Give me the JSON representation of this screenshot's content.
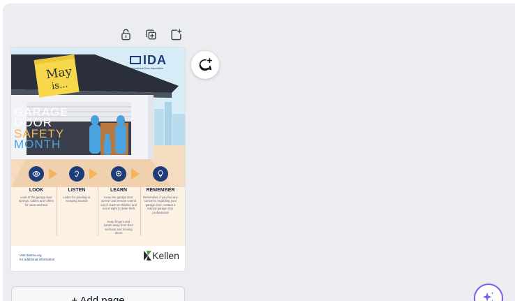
{
  "toolbar": {
    "lock_icon": "lock-icon",
    "duplicate_icon": "duplicate-page-icon",
    "add_icon": "add-page-icon"
  },
  "poster": {
    "sticky_note": {
      "line1": "May",
      "line2": "is..."
    },
    "brand": {
      "logo": "IDA",
      "subtitle": "International Door Association"
    },
    "headline": {
      "line1": "GARAGE",
      "line2": "DOOR",
      "line3": "SAFETY",
      "line4": "MONTH"
    },
    "steps": [
      {
        "title": "LOOK",
        "text": "Look at the garage door springs, cables and rollers for wear and tear",
        "icon": "eye-icon"
      },
      {
        "title": "LISTEN",
        "text": "Listen for grinding or scraping sounds",
        "icon": "ear-icon"
      },
      {
        "title": "LEARN",
        "text": "Keep the garage door opener and remote control out of reach of children and out of sight to deter theft",
        "text2": "Keep fingers and hands away from door sections and moving doors",
        "icon": "brain-icon"
      },
      {
        "title": "REMEMBER",
        "text": "Remember, if you find any concerns regarding your garage door, contact a trained garage door professional",
        "icon": "lightbulb-icon"
      }
    ],
    "footer": {
      "line1": "Visit dasma.org",
      "line2": "for additional information",
      "sponsor": "Kellen"
    }
  },
  "actions": {
    "add_page_label": "+ Add page"
  },
  "colors": {
    "canvas_bg": "#ecedf0",
    "poster_navy": "#1d3d78",
    "poster_orange": "#f4b45a",
    "poster_blue_figures": "#4aa3df",
    "assistant_accent": "#7a5cf0"
  }
}
